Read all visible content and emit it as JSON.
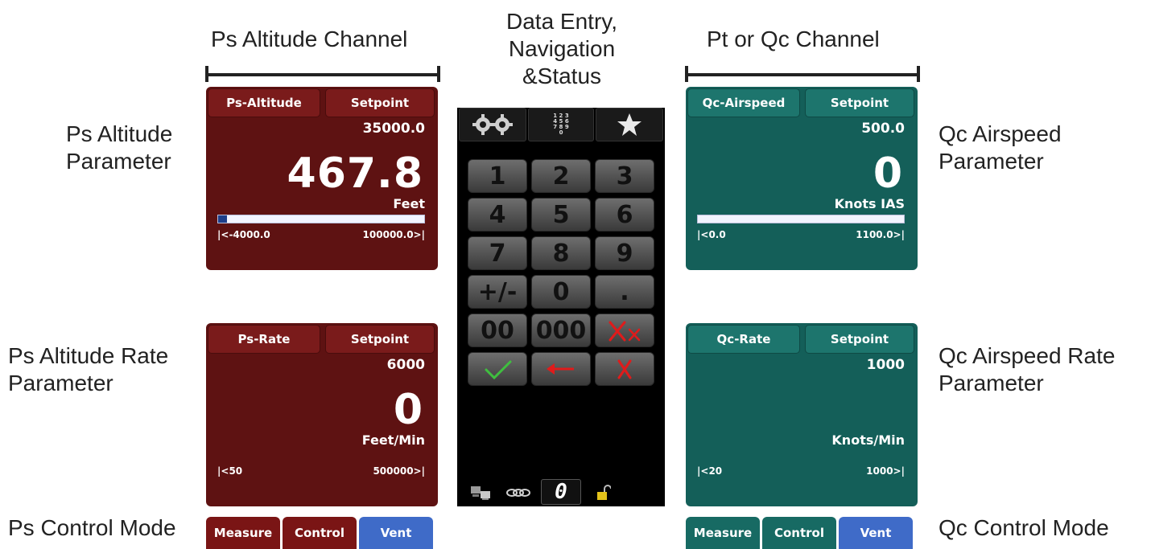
{
  "headers": {
    "left": "Ps Altitude Channel",
    "center": [
      "Data Entry,",
      "Navigation",
      "&Status"
    ],
    "right": "Pt or Qc Channel"
  },
  "labels": {
    "ps_altitude_param": [
      "Ps Altitude",
      "Parameter"
    ],
    "ps_rate_param": [
      "Ps Altitude Rate",
      "Parameter"
    ],
    "ps_control_mode": "Ps Control Mode",
    "qc_airspeed_param": [
      "Qc Airspeed",
      "Parameter"
    ],
    "qc_rate_param": [
      "Qc Airspeed Rate",
      "Parameter"
    ],
    "qc_control_mode": "Qc Control Mode"
  },
  "ps_altitude": {
    "name_button": "Ps-Altitude",
    "setpoint_button": "Setpoint",
    "setpoint_value": "35000.0",
    "value": "467.8",
    "units": "Feet",
    "range_min": "|<-4000.0",
    "range_max": "100000.0>|",
    "bar_fraction": 0.043
  },
  "ps_rate": {
    "name_button": "Ps-Rate",
    "setpoint_button": "Setpoint",
    "setpoint_value": "6000",
    "value": "0",
    "units": "Feet/Min",
    "range_min": "|<50",
    "range_max": "500000>|"
  },
  "qc_airspeed": {
    "name_button": "Qc-Airspeed",
    "setpoint_button": "Setpoint",
    "setpoint_value": "500.0",
    "value": "0",
    "units": "Knots IAS",
    "range_min": "|<0.0",
    "range_max": "1100.0>|",
    "bar_fraction": 0.0
  },
  "qc_rate": {
    "name_button": "Qc-Rate",
    "setpoint_button": "Setpoint",
    "setpoint_value": "1000",
    "units": "Knots/Min",
    "range_min": "|<20",
    "range_max": "1000>|"
  },
  "ps_mode": {
    "measure": "Measure",
    "control": "Control",
    "vent": "Vent"
  },
  "qc_mode": {
    "measure": "Measure",
    "control": "Control",
    "vent": "Vent"
  },
  "keypad": {
    "mini_numpad": [
      "1 2 3",
      "4 5 6",
      "7 8 9",
      "0"
    ],
    "keys": [
      "1",
      "2",
      "3",
      "4",
      "5",
      "6",
      "7",
      "8",
      "9",
      "+/-",
      "0",
      ".",
      "00",
      "000"
    ],
    "status_value": "0",
    "colors": {
      "accept": "#3fbf3f",
      "cancel": "#e01b1b"
    }
  }
}
